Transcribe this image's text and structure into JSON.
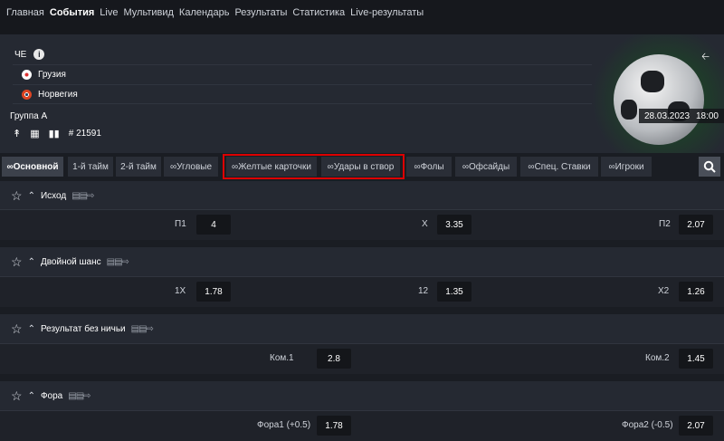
{
  "nav": [
    "Главная",
    "События",
    "Live",
    "Мультивид",
    "Календарь",
    "Результаты",
    "Статистика",
    "Live-результаты"
  ],
  "nav_active_index": 1,
  "event": {
    "championship": "ЧЕ",
    "team1": "Грузия",
    "team2": "Норвегия",
    "group": "Группа A",
    "match_id": "# 21591",
    "date": "28.03.2023",
    "time": "18:00"
  },
  "tabs": [
    "Основной",
    "1-й тайм",
    "2-й тайм",
    "Угловые",
    "Желтые карточки",
    "Удары в створ",
    "Фолы",
    "Офсайды",
    "Спец. Ставки",
    "Игроки"
  ],
  "markets": [
    {
      "title": "Исход",
      "outcomes": [
        {
          "label": "П1",
          "odd": "4"
        },
        {
          "label": "X",
          "odd": "3.35"
        },
        {
          "label": "П2",
          "odd": "2.07"
        }
      ]
    },
    {
      "title": "Двойной шанс",
      "outcomes": [
        {
          "label": "1X",
          "odd": "1.78"
        },
        {
          "label": "12",
          "odd": "1.35"
        },
        {
          "label": "X2",
          "odd": "1.26"
        }
      ]
    },
    {
      "title": "Результат без ничьи",
      "outcomes": [
        {
          "label": "Ком.1",
          "odd": "2.8"
        },
        {
          "label": "Ком.2",
          "odd": "1.45"
        }
      ]
    },
    {
      "title": "Фора",
      "outcomes": [
        {
          "label": "Фора1 (+0.5)",
          "odd": "1.78"
        },
        {
          "label": "Фора2 (-0.5)",
          "odd": "2.07"
        }
      ]
    }
  ],
  "colors": {
    "highlight": "#dd0000",
    "background": "#1c1f25"
  }
}
